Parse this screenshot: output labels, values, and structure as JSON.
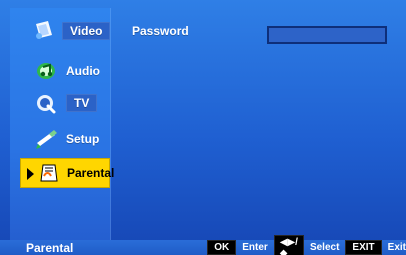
{
  "sidebar": {
    "items": [
      {
        "label": "Video",
        "icon": "video-icon"
      },
      {
        "label": "Audio",
        "icon": "audio-icon"
      },
      {
        "label": "TV",
        "icon": "tv-icon"
      },
      {
        "label": "Setup",
        "icon": "setup-icon"
      },
      {
        "label": "Parental",
        "icon": "parental-icon"
      }
    ],
    "selected": "Parental"
  },
  "main": {
    "password_label": "Password",
    "password_value": ""
  },
  "footer": {
    "current_section": "Parental",
    "keys": {
      "ok_label": "OK",
      "enter_label": "Enter",
      "arrows_label": "◀▶/◆",
      "select_label": "Select",
      "exit_key_label": "EXIT",
      "exit_label": "Exit"
    }
  },
  "colors": {
    "background_blue": "#1f5fd1",
    "selection_yellow": "#ffd600"
  }
}
